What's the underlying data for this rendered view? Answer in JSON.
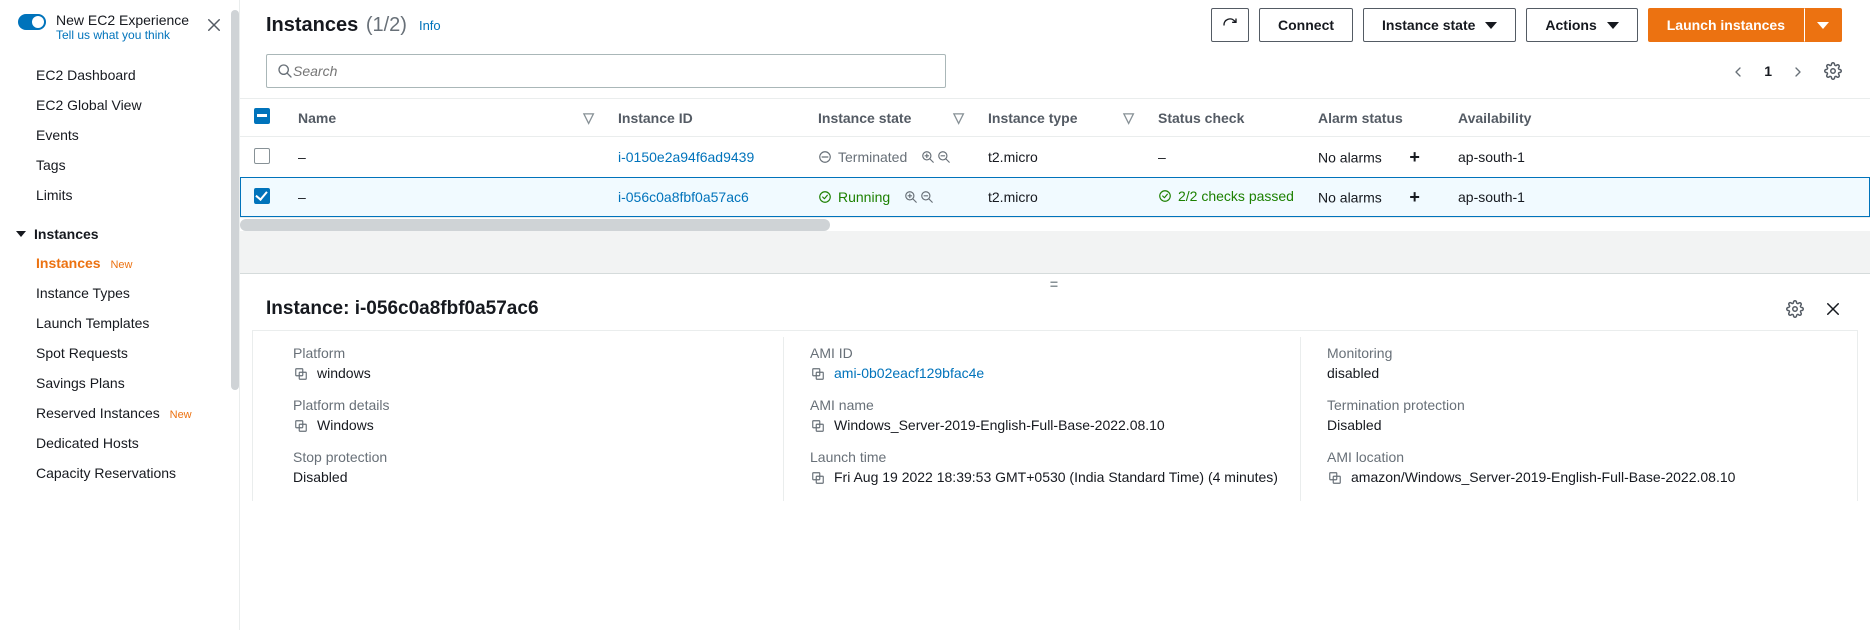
{
  "sidebar": {
    "nex_title": "New EC2 Experience",
    "nex_sub": "Tell us what you think",
    "top_items": [
      "EC2 Dashboard",
      "EC2 Global View",
      "Events",
      "Tags",
      "Limits"
    ],
    "section_head": "Instances",
    "section_items": [
      {
        "label": "Instances",
        "active": true,
        "new": true
      },
      {
        "label": "Instance Types"
      },
      {
        "label": "Launch Templates"
      },
      {
        "label": "Spot Requests"
      },
      {
        "label": "Savings Plans"
      },
      {
        "label": "Reserved Instances",
        "new": true
      },
      {
        "label": "Dedicated Hosts"
      },
      {
        "label": "Capacity Reservations"
      }
    ]
  },
  "header": {
    "title": "Instances",
    "count": "(1/2)",
    "info": "Info",
    "connect": "Connect",
    "instance_state": "Instance state",
    "actions": "Actions",
    "launch": "Launch instances"
  },
  "search": {
    "placeholder": "Search"
  },
  "pager": {
    "page": "1"
  },
  "table": {
    "columns": {
      "name": "Name",
      "instance_id": "Instance ID",
      "instance_state": "Instance state",
      "instance_type": "Instance type",
      "status_check": "Status check",
      "alarm_status": "Alarm status",
      "az": "Availability"
    },
    "rows": [
      {
        "checked": false,
        "name": "–",
        "instance_id": "i-0150e2a94f6ad9439",
        "state": "Terminated",
        "state_kind": "terminated",
        "type": "t2.micro",
        "status": "–",
        "alarm": "No alarms",
        "az": "ap-south-1"
      },
      {
        "checked": true,
        "name": "–",
        "instance_id": "i-056c0a8fbf0a57ac6",
        "state": "Running",
        "state_kind": "running",
        "type": "t2.micro",
        "status": "2/2 checks passed",
        "alarm": "No alarms",
        "az": "ap-south-1"
      }
    ]
  },
  "details": {
    "title_prefix": "Instance: ",
    "title_id": "i-056c0a8fbf0a57ac6",
    "col1": {
      "platform_k": "Platform",
      "platform_v": "windows",
      "platform_details_k": "Platform details",
      "platform_details_v": "Windows",
      "stop_protection_k": "Stop protection",
      "stop_protection_v": "Disabled"
    },
    "col2": {
      "ami_id_k": "AMI ID",
      "ami_id_v": "ami-0b02eacf129bfac4e",
      "ami_name_k": "AMI name",
      "ami_name_v": "Windows_Server-2019-English-Full-Base-2022.08.10",
      "launch_time_k": "Launch time",
      "launch_time_v": "Fri Aug 19 2022 18:39:53 GMT+0530 (India Standard Time) (4 minutes)"
    },
    "col3": {
      "monitoring_k": "Monitoring",
      "monitoring_v": "disabled",
      "term_prot_k": "Termination protection",
      "term_prot_v": "Disabled",
      "ami_loc_k": "AMI location",
      "ami_loc_v": "amazon/Windows_Server-2019-English-Full-Base-2022.08.10"
    }
  },
  "badges": {
    "new": "New"
  }
}
